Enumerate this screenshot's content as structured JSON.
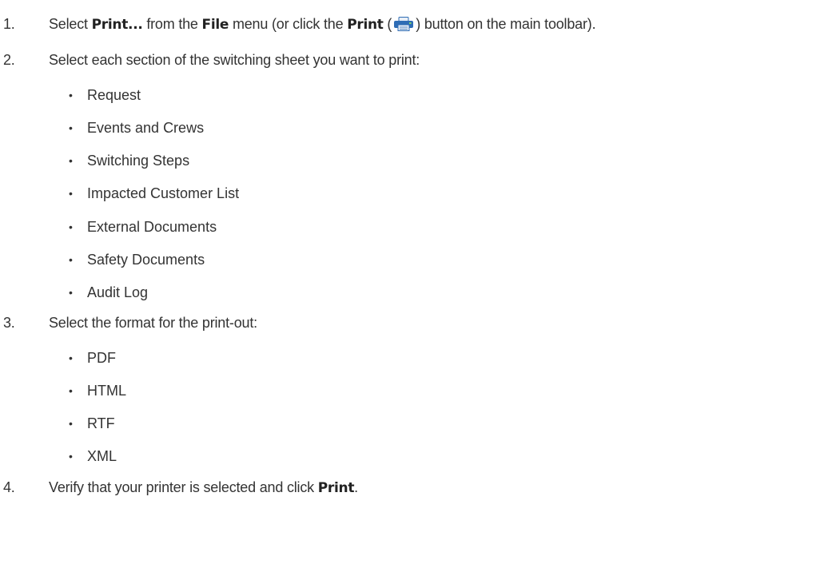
{
  "steps": [
    {
      "number": "1.",
      "parts": {
        "a": "Select ",
        "b1": "Print...",
        "c": " from the ",
        "b2": "File",
        "d": " menu (or click the ",
        "b3": "Print",
        "e": " (",
        "f": ") button on the main toolbar)."
      },
      "icon": "printer-icon"
    },
    {
      "number": "2.",
      "text": "Select each section of the switching sheet you want to print:",
      "bullets": [
        "Request",
        "Events and Crews",
        "Switching Steps",
        "Impacted Customer List",
        "External Documents",
        "Safety Documents",
        "Audit Log"
      ]
    },
    {
      "number": "3.",
      "text": "Select the format for the print-out:",
      "bullets": [
        "PDF",
        "HTML",
        "RTF",
        "XML"
      ]
    },
    {
      "number": "4.",
      "parts": {
        "a": "Verify that your printer is selected and click ",
        "b1": "Print",
        "c": "."
      }
    }
  ],
  "bullet_glyph": "•",
  "colors": {
    "text": "#333333",
    "icon_blue": "#2f6db5",
    "icon_light": "#e8eef6"
  }
}
